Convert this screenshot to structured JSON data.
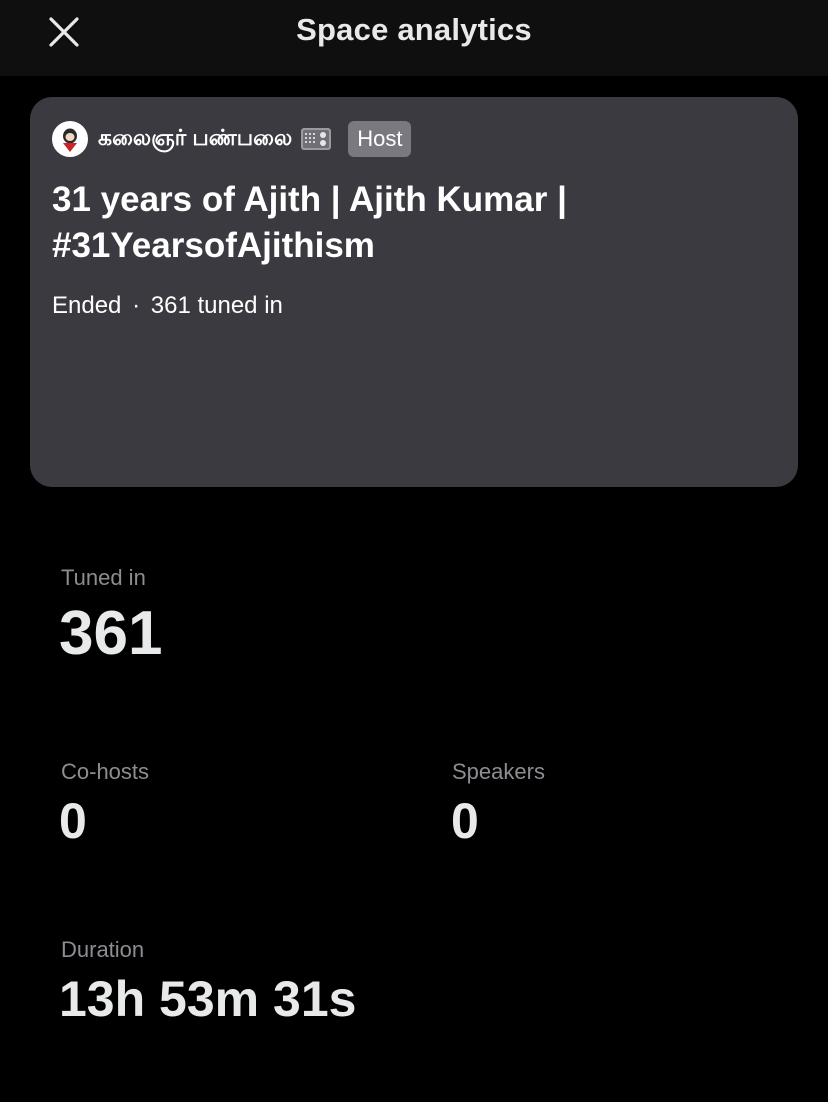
{
  "header": {
    "title": "Space analytics",
    "close_icon": "close-icon"
  },
  "space": {
    "host_name": "கலைஞர் பண்பலை",
    "host_emoji_icon": "radio-icon",
    "host_badge": "Host",
    "title": "31 years of Ajith | Ajith Kumar | #31YearsofAjithism",
    "status": "Ended",
    "separator": "·",
    "tuned_in_text": "361 tuned in"
  },
  "stats": {
    "tuned_in": {
      "label": "Tuned in",
      "value": "361"
    },
    "co_hosts": {
      "label": "Co-hosts",
      "value": "0"
    },
    "speakers": {
      "label": "Speakers",
      "value": "0"
    },
    "duration": {
      "label": "Duration",
      "value": "13h 53m 31s"
    }
  },
  "colors": {
    "background": "#000000",
    "header_background": "#0f0f10",
    "card_background": "#3b3a40",
    "badge_background": "#7a797f",
    "label_text": "#8b8d91",
    "primary_text": "#e7e9ea"
  }
}
